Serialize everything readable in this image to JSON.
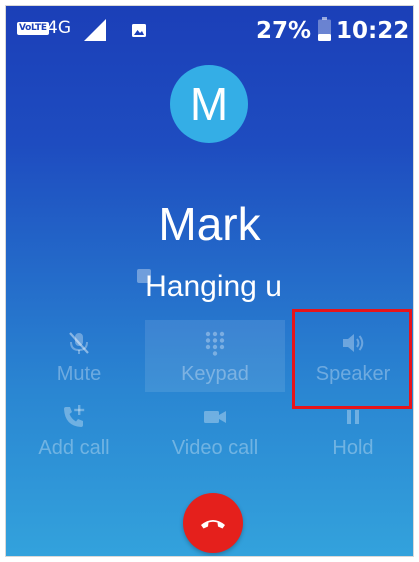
{
  "status_bar": {
    "volte": "VoLTE",
    "network": "4G",
    "battery_percent": "27%",
    "time": "10:22"
  },
  "caller": {
    "initial": "M",
    "name": "Mark",
    "call_status": "Hanging u"
  },
  "controls": [
    {
      "label": "Mute",
      "icon": "mic-off-icon"
    },
    {
      "label": "Keypad",
      "icon": "dialpad-icon"
    },
    {
      "label": "Speaker",
      "icon": "speaker-icon"
    },
    {
      "label": "Add call",
      "icon": "add-call-icon"
    },
    {
      "label": "Video call",
      "icon": "videocam-icon"
    },
    {
      "label": "Hold",
      "icon": "pause-icon"
    }
  ],
  "end_call": {
    "icon": "call-end-icon"
  },
  "colors": {
    "background_top": "#1b3fb8",
    "background_bottom": "#33a2dc",
    "avatar": "#34aee6",
    "end_call": "#e5201c",
    "highlight": "#e8141a"
  }
}
